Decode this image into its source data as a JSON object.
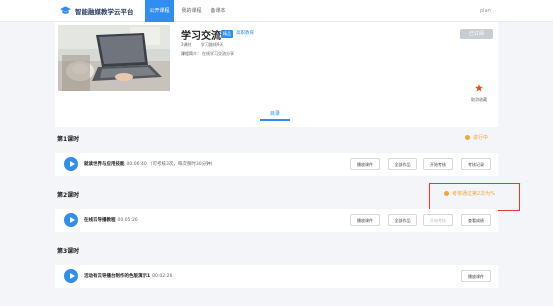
{
  "header": {
    "logo_text": "智能融媒教学云平台",
    "nav": [
      {
        "label": "公开课程",
        "active": true
      },
      {
        "label": "我的课程",
        "active": false
      },
      {
        "label": "备课本",
        "active": false
      }
    ],
    "user": "plan"
  },
  "course": {
    "title": "学习交流",
    "badge": "精品",
    "teacher": "高职教育",
    "meta_items": [
      "3课时",
      "学习路线9天"
    ],
    "intro_label": "课程简介：",
    "intro": "在线学习交流分享",
    "status_button": "已订阅",
    "favorite_label": "取消收藏",
    "toc_tab": "目录"
  },
  "lessons": [
    {
      "title": "第1课时",
      "status": "进行中",
      "row": {
        "name": "就读世界与应用技能",
        "duration": "00:06:40",
        "note": "(可考核3次，每次限时30分钟)",
        "buttons": [
          "播放课件",
          "全部作品",
          "开始考核",
          "考核记录"
        ]
      }
    },
    {
      "title": "第2课时",
      "status": "考核通过第2次为%",
      "row": {
        "name": "在线云导播教程",
        "duration": "00:05:26",
        "note": "",
        "buttons": [
          "播放课件",
          "全部作品",
          "开始考核",
          "查看成绩"
        ]
      }
    },
    {
      "title": "第3课时",
      "status": "",
      "row": {
        "name": "活动有云导播台制作的色版演示1",
        "duration": "00:02:26",
        "note": "",
        "buttons": [
          "播放课件"
        ]
      }
    }
  ],
  "colors": {
    "accent": "#2f8ef0",
    "status_dot": "#f2a53a",
    "highlight_box": "#e53935"
  }
}
